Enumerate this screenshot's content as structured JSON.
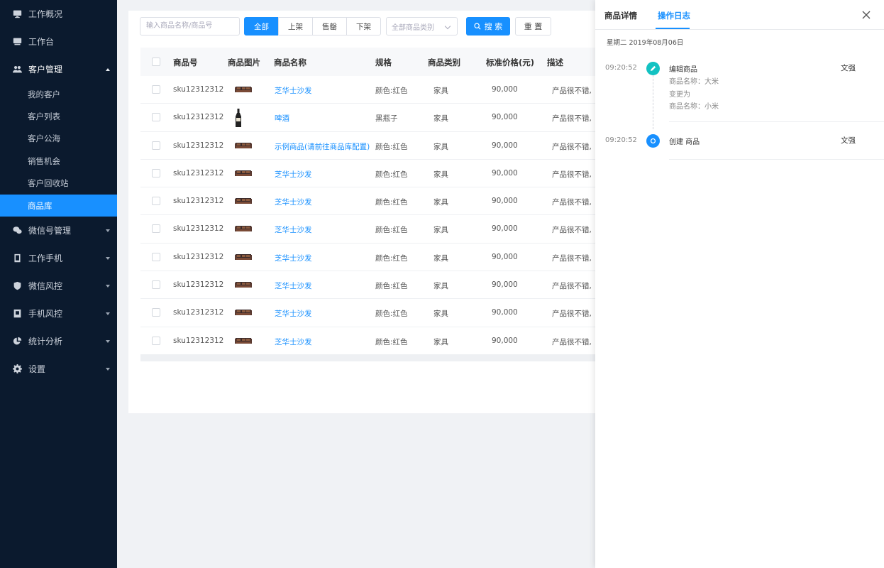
{
  "sidebar": {
    "items": [
      {
        "label": "工作概况",
        "icon": "monitor-icon"
      },
      {
        "label": "工作台",
        "icon": "desk-icon"
      },
      {
        "label": "客户管理",
        "icon": "users-icon"
      },
      {
        "label": "微信号管理",
        "icon": "wechat-icon"
      },
      {
        "label": "工作手机",
        "icon": "phone-icon"
      },
      {
        "label": "微信风控",
        "icon": "shield-icon"
      },
      {
        "label": "手机风控",
        "icon": "phone-shield-icon"
      },
      {
        "label": "统计分析",
        "icon": "pie-chart-icon"
      },
      {
        "label": "设置",
        "icon": "gear-icon"
      }
    ],
    "sub_items": [
      "我的客户",
      "客户列表",
      "客户公海",
      "销售机会",
      "客户回收站",
      "商品库"
    ],
    "active_sub": "商品库"
  },
  "toolbar": {
    "search_placeholder": "输入商品名称/商品号",
    "filters": [
      "全部",
      "上架",
      "售罄",
      "下架"
    ],
    "active_filter": "全部",
    "category_placeholder": "全部商品类别",
    "search_label": "搜 索",
    "reset_label": "重 置"
  },
  "table": {
    "columns": [
      "商品号",
      "商品图片",
      "商品名称",
      "规格",
      "商品类别",
      "标准价格(元)",
      "描述"
    ],
    "rows": [
      {
        "sku": "sku12312312",
        "image": "sofa",
        "name": "芝华士沙发",
        "spec": "颜色:红色",
        "category": "家具",
        "price": "90,000",
        "desc": "产品很不错,"
      },
      {
        "sku": "sku12312312",
        "image": "beer",
        "name": "啤酒",
        "spec": "黑瓶子",
        "category": "家具",
        "price": "90,000",
        "desc": "产品很不错,"
      },
      {
        "sku": "sku12312312",
        "image": "sofa",
        "name": "示例商品(请前往商品库配置)",
        "spec": "颜色:红色",
        "category": "家具",
        "price": "90,000",
        "desc": "产品很不错,"
      },
      {
        "sku": "sku12312312",
        "image": "sofa",
        "name": "芝华士沙发",
        "spec": "颜色:红色",
        "category": "家具",
        "price": "90,000",
        "desc": "产品很不错,"
      },
      {
        "sku": "sku12312312",
        "image": "sofa",
        "name": "芝华士沙发",
        "spec": "颜色:红色",
        "category": "家具",
        "price": "90,000",
        "desc": "产品很不错,"
      },
      {
        "sku": "sku12312312",
        "image": "sofa",
        "name": "芝华士沙发",
        "spec": "颜色:红色",
        "category": "家具",
        "price": "90,000",
        "desc": "产品很不错,"
      },
      {
        "sku": "sku12312312",
        "image": "sofa",
        "name": "芝华士沙发",
        "spec": "颜色:红色",
        "category": "家具",
        "price": "90,000",
        "desc": "产品很不错,"
      },
      {
        "sku": "sku12312312",
        "image": "sofa",
        "name": "芝华士沙发",
        "spec": "颜色:红色",
        "category": "家具",
        "price": "90,000",
        "desc": "产品很不错,"
      },
      {
        "sku": "sku12312312",
        "image": "sofa",
        "name": "芝华士沙发",
        "spec": "颜色:红色",
        "category": "家具",
        "price": "90,000",
        "desc": "产品很不错,"
      },
      {
        "sku": "sku12312312",
        "image": "sofa",
        "name": "芝华士沙发",
        "spec": "颜色:红色",
        "category": "家具",
        "price": "90,000",
        "desc": "产品很不错,"
      }
    ]
  },
  "drawer": {
    "tabs": [
      "商品详情",
      "操作日志"
    ],
    "active_tab": "操作日志",
    "date": "星期二   2019年08月06日",
    "logs": [
      {
        "time": "09:20:52",
        "icon": "edit-icon",
        "color": "#13c2c2",
        "title": "编辑商品",
        "details": [
          "商品名称：大米",
          "变更为",
          "商品名称：小米"
        ],
        "user": "文强"
      },
      {
        "time": "09:20:52",
        "icon": "create-icon",
        "color": "#1890ff",
        "title": "创建 商品",
        "details": [],
        "user": "文强"
      }
    ]
  },
  "colors": {
    "accent": "#1890ff",
    "sidebar_bg": "#0b1a2e",
    "edit_dot": "#13c2c2"
  }
}
